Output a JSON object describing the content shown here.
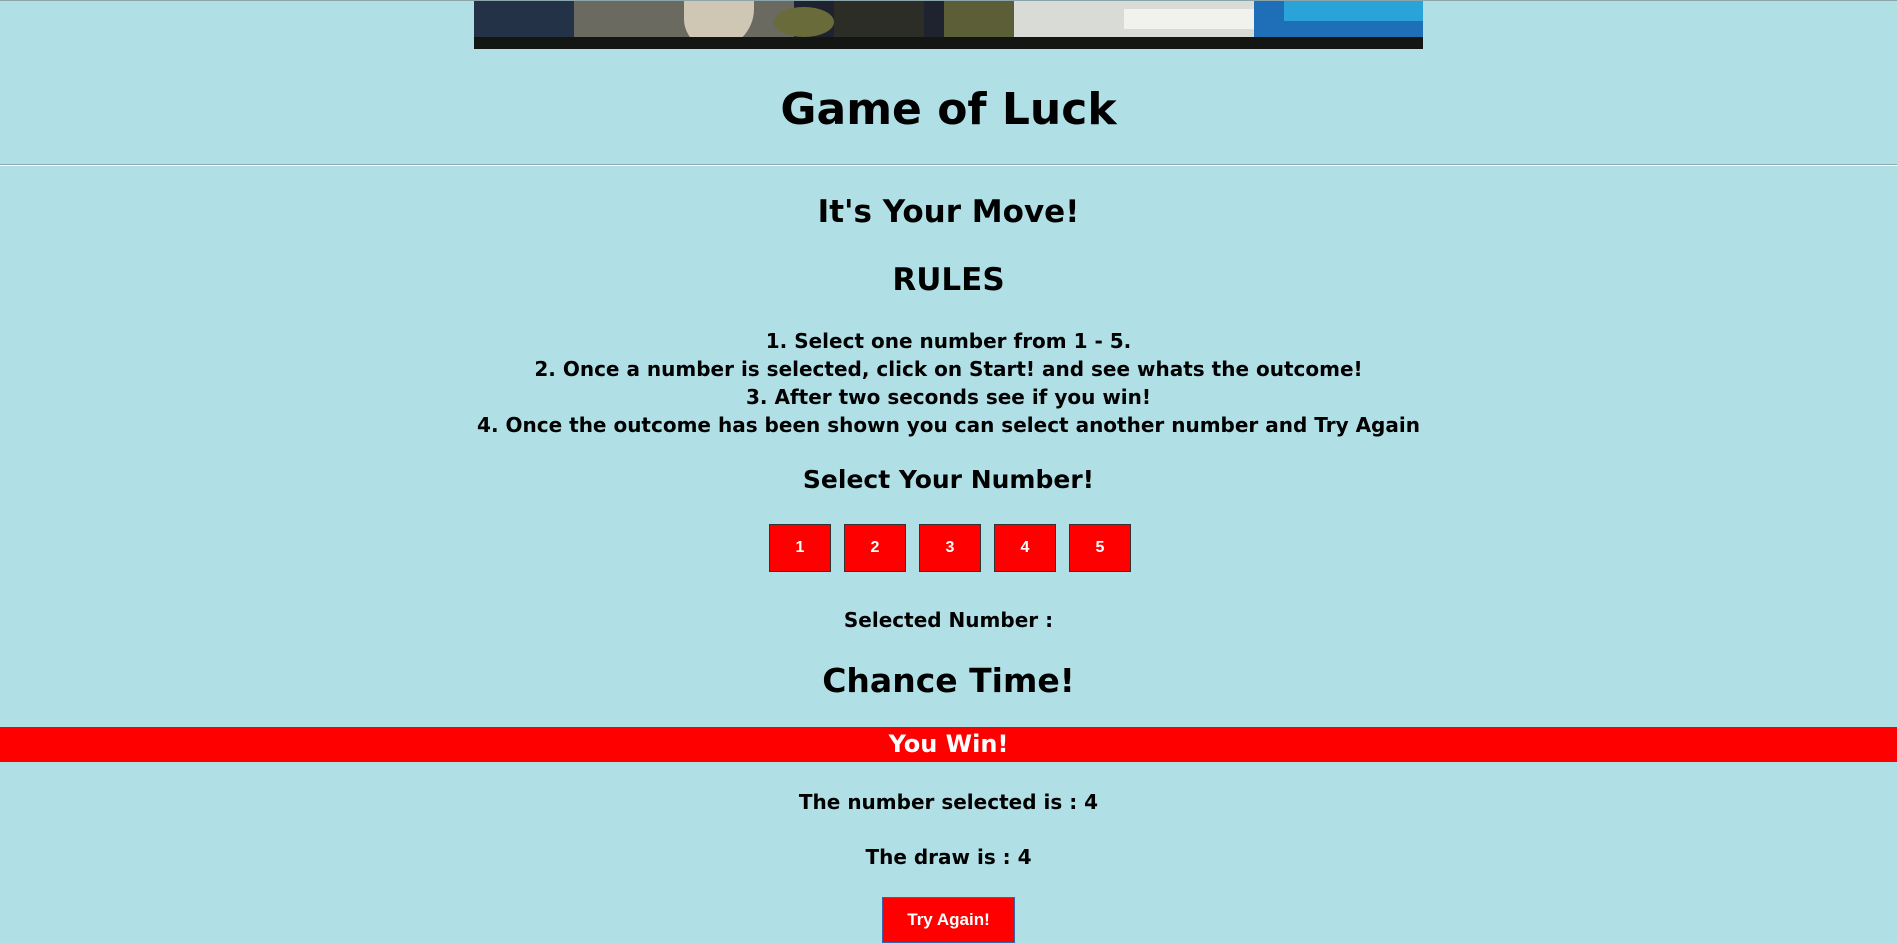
{
  "header": {
    "title": "Game of Luck"
  },
  "main": {
    "subtitle": "It's Your Move!",
    "rules_heading": "RULES",
    "rules": [
      "1. Select one number from 1 - 5.",
      "2. Once a number is selected, click on Start! and see whats the outcome!",
      "3. After two seconds see if you win!",
      "4. Once the outcome has been shown you can select another number and Try Again"
    ],
    "select_heading": "Select Your Number!",
    "numbers": [
      "1",
      "2",
      "3",
      "4",
      "5"
    ],
    "selected_label": "Selected Number :",
    "chance_heading": "Chance Time!",
    "result": "You Win!",
    "number_selected_text": "The number selected is : 4",
    "draw_text": "The draw is : 4",
    "try_again_label": "Try Again!"
  },
  "colors": {
    "background": "#b0e0e6",
    "accent": "#ff0000",
    "text": "#000000"
  }
}
